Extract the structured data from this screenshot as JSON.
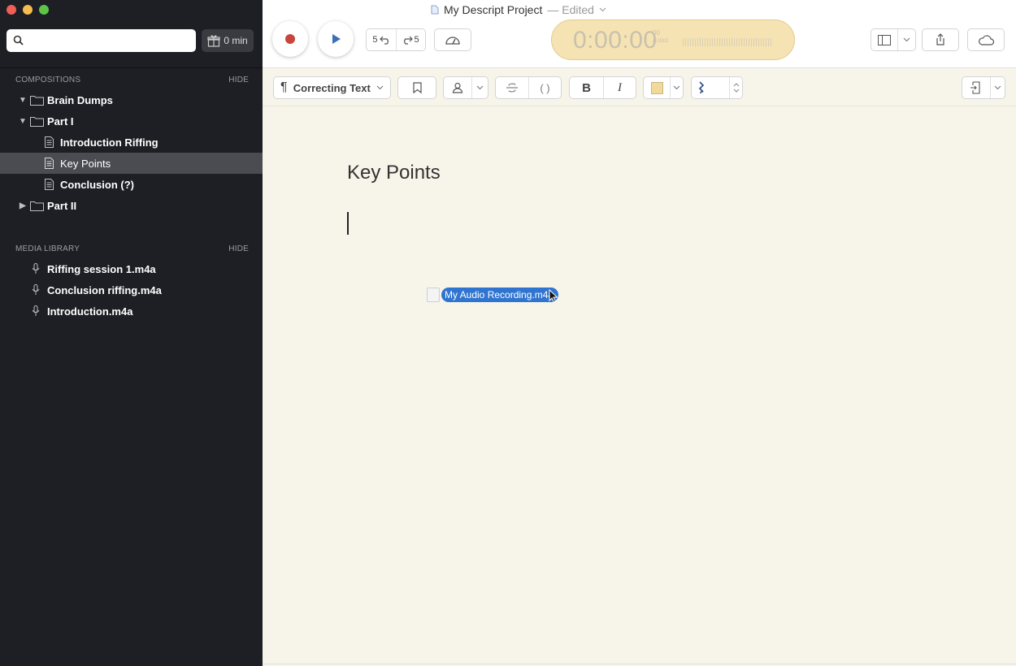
{
  "window": {
    "title": "My Descript Project",
    "status": "— Edited"
  },
  "sidebar": {
    "search": {
      "placeholder": "",
      "value": ""
    },
    "minutes_label": "0 min",
    "compositions": {
      "heading": "COMPOSITIONS",
      "hide_label": "HIDE",
      "items": [
        {
          "label": "Brain Dumps",
          "type": "folder",
          "expanded": true
        },
        {
          "label": "Part I",
          "type": "folder",
          "expanded": true
        },
        {
          "label": "Introduction Riffing",
          "type": "doc"
        },
        {
          "label": "Key Points",
          "type": "doc",
          "selected": true
        },
        {
          "label": "Conclusion (?)",
          "type": "doc"
        },
        {
          "label": "Part II",
          "type": "folder",
          "expanded": false
        }
      ]
    },
    "media_library": {
      "heading": "MEDIA LIBRARY",
      "hide_label": "HIDE",
      "items": [
        {
          "label": "Riffing session 1.m4a"
        },
        {
          "label": "Conclusion riffing.m4a"
        },
        {
          "label": "Introduction.m4a"
        }
      ]
    }
  },
  "toolbar": {
    "skip_back_label": "5",
    "skip_forward_label": "5",
    "timecode": "0:00:00",
    "timecode_frames": "00",
    "timecode_sub": "AUDIO",
    "colors": {
      "record": "#c8453c",
      "play": "#3b6fb6"
    }
  },
  "format_toolbar": {
    "style_label": "Correcting Text"
  },
  "document": {
    "title": "Key Points",
    "dragged_file": "My Audio Recording.m4a"
  }
}
